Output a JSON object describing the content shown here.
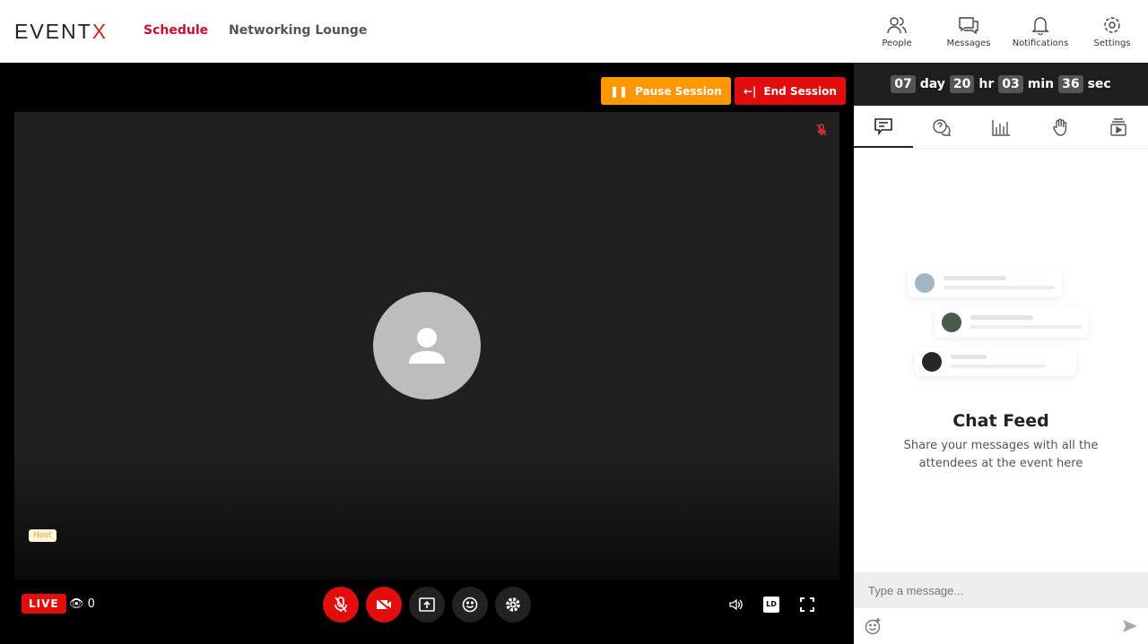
{
  "header": {
    "logo": "EVENTX",
    "logo_main": "EVENT",
    "logo_accent": "X",
    "nav": [
      {
        "label": "Schedule",
        "active": true
      },
      {
        "label": "Networking Lounge",
        "active": false
      }
    ],
    "icons": [
      {
        "label": "People",
        "icon": "people-icon"
      },
      {
        "label": "Messages",
        "icon": "messages-icon"
      },
      {
        "label": "Notifications",
        "icon": "bell-icon"
      },
      {
        "label": "Settings",
        "icon": "gear-icon"
      }
    ]
  },
  "stage": {
    "pause_label": "Pause Session",
    "end_label": "End Session",
    "host_badge": "Host",
    "live_badge": "LIVE",
    "viewers": "0",
    "quality": "LD"
  },
  "sidebar": {
    "timer": [
      {
        "value": "07",
        "unit": "day"
      },
      {
        "value": "20",
        "unit": "hr"
      },
      {
        "value": "03",
        "unit": "min"
      },
      {
        "value": "36",
        "unit": "sec"
      }
    ],
    "tabs": [
      "chat",
      "qna",
      "polls",
      "raise-hand",
      "media"
    ],
    "empty_title": "Chat Feed",
    "empty_text": "Share your messages with all the attendees at the event here",
    "input_placeholder": "Type a message..."
  },
  "colors": {
    "accent": "#e20d0d",
    "pause": "#ff9800",
    "nav_active": "#c8102e"
  }
}
